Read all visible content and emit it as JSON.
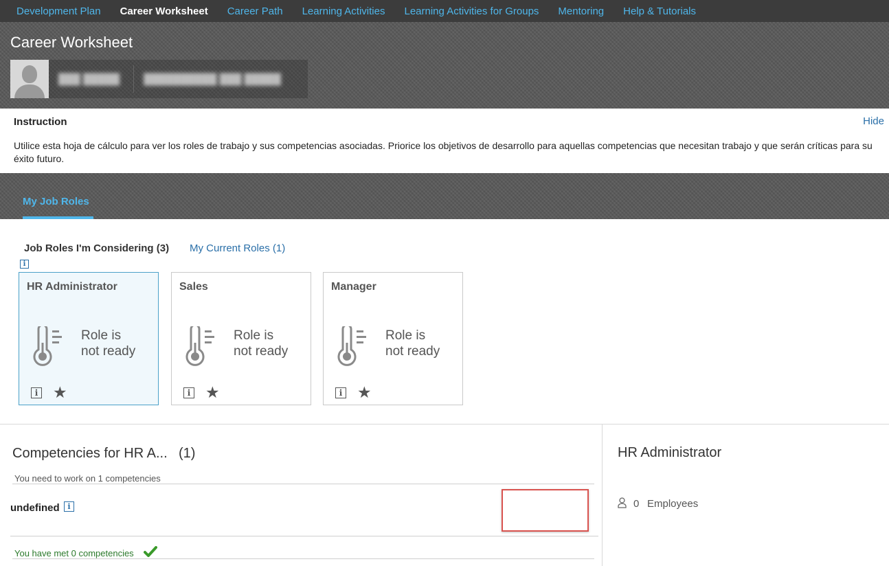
{
  "nav": {
    "items": [
      {
        "label": "Development Plan"
      },
      {
        "label": "Career Worksheet",
        "active": true
      },
      {
        "label": "Career Path"
      },
      {
        "label": "Learning Activities"
      },
      {
        "label": "Learning Activities for Groups"
      },
      {
        "label": "Mentoring"
      },
      {
        "label": "Help & Tutorials"
      }
    ]
  },
  "header": {
    "title": "Career Worksheet",
    "avatar_icon": "user-silhouette-icon"
  },
  "instruction": {
    "title": "Instruction",
    "hide_label": "Hide",
    "text": "Utilice esta hoja de cálculo para ver los roles de trabajo y sus competencias asociadas. Priorice los objetivos de desarrollo para aquellas competencias que necesitan trabajo y que serán críticas para su éxito futuro."
  },
  "tabs": {
    "main_tab": "My Job Roles",
    "sub_tabs": [
      {
        "label": "Job Roles I'm Considering (3)",
        "active": true
      },
      {
        "label": "My Current Roles (1)"
      }
    ]
  },
  "roles": [
    {
      "name": "HR Administrator",
      "status_line1": "Role is",
      "status_line2": "not ready",
      "selected": true
    },
    {
      "name": "Sales",
      "status_line1": "Role is",
      "status_line2": "not ready",
      "selected": false
    },
    {
      "name": "Manager",
      "status_line1": "Role is",
      "status_line2": "not ready",
      "selected": false
    }
  ],
  "competencies": {
    "title": "Competencies for HR A...",
    "count": "(1)",
    "need_work_text": "You need to work on 1 competencies",
    "items": [
      {
        "name": "undefined"
      }
    ],
    "met_text": "You have met 0 competencies"
  },
  "detail": {
    "title": "HR Administrator",
    "employee_count": "0",
    "employee_label": "Employees"
  },
  "colors": {
    "nav_bg": "#3c3c3c",
    "link": "#4fb6ea",
    "accent_blue": "#2a6fa8",
    "success_green": "#2b7a2b",
    "highlight_red": "#d9534f"
  }
}
